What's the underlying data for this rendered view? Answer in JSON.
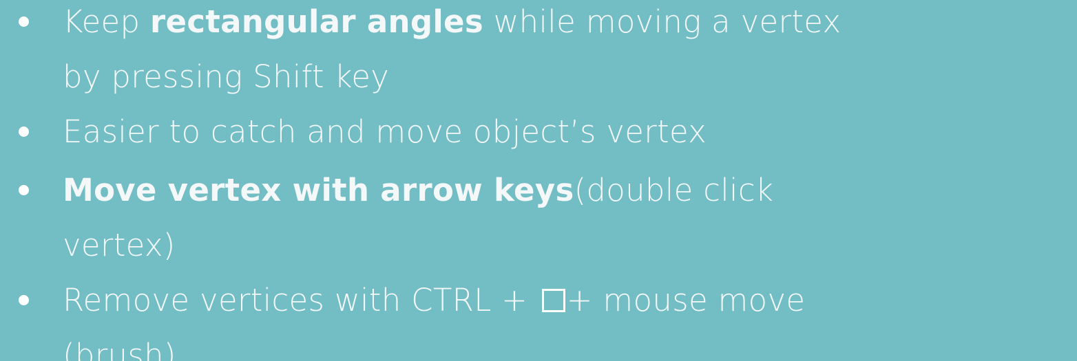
{
  "colors": {
    "background": "#73bdc5",
    "text": "#f4f8f8",
    "bullet": "#ffffff"
  },
  "bullets": [
    {
      "line1_pre": "Keep ",
      "line1_bold": "rectangular angles",
      "line1_post": " while moving a vertex",
      "line2": "by pressing Shift key"
    },
    {
      "line1": "Easier to catch and move object’s vertex"
    },
    {
      "line1_bold": "Move vertex with arrow keys",
      "line1_post": "(double click",
      "line2": "vertex)"
    },
    {
      "line1_pre": "Remove vertices with CTRL + ",
      "icon": "square-brush-icon",
      "line1_post": "+ mouse move",
      "line2": "(brush)"
    }
  ]
}
